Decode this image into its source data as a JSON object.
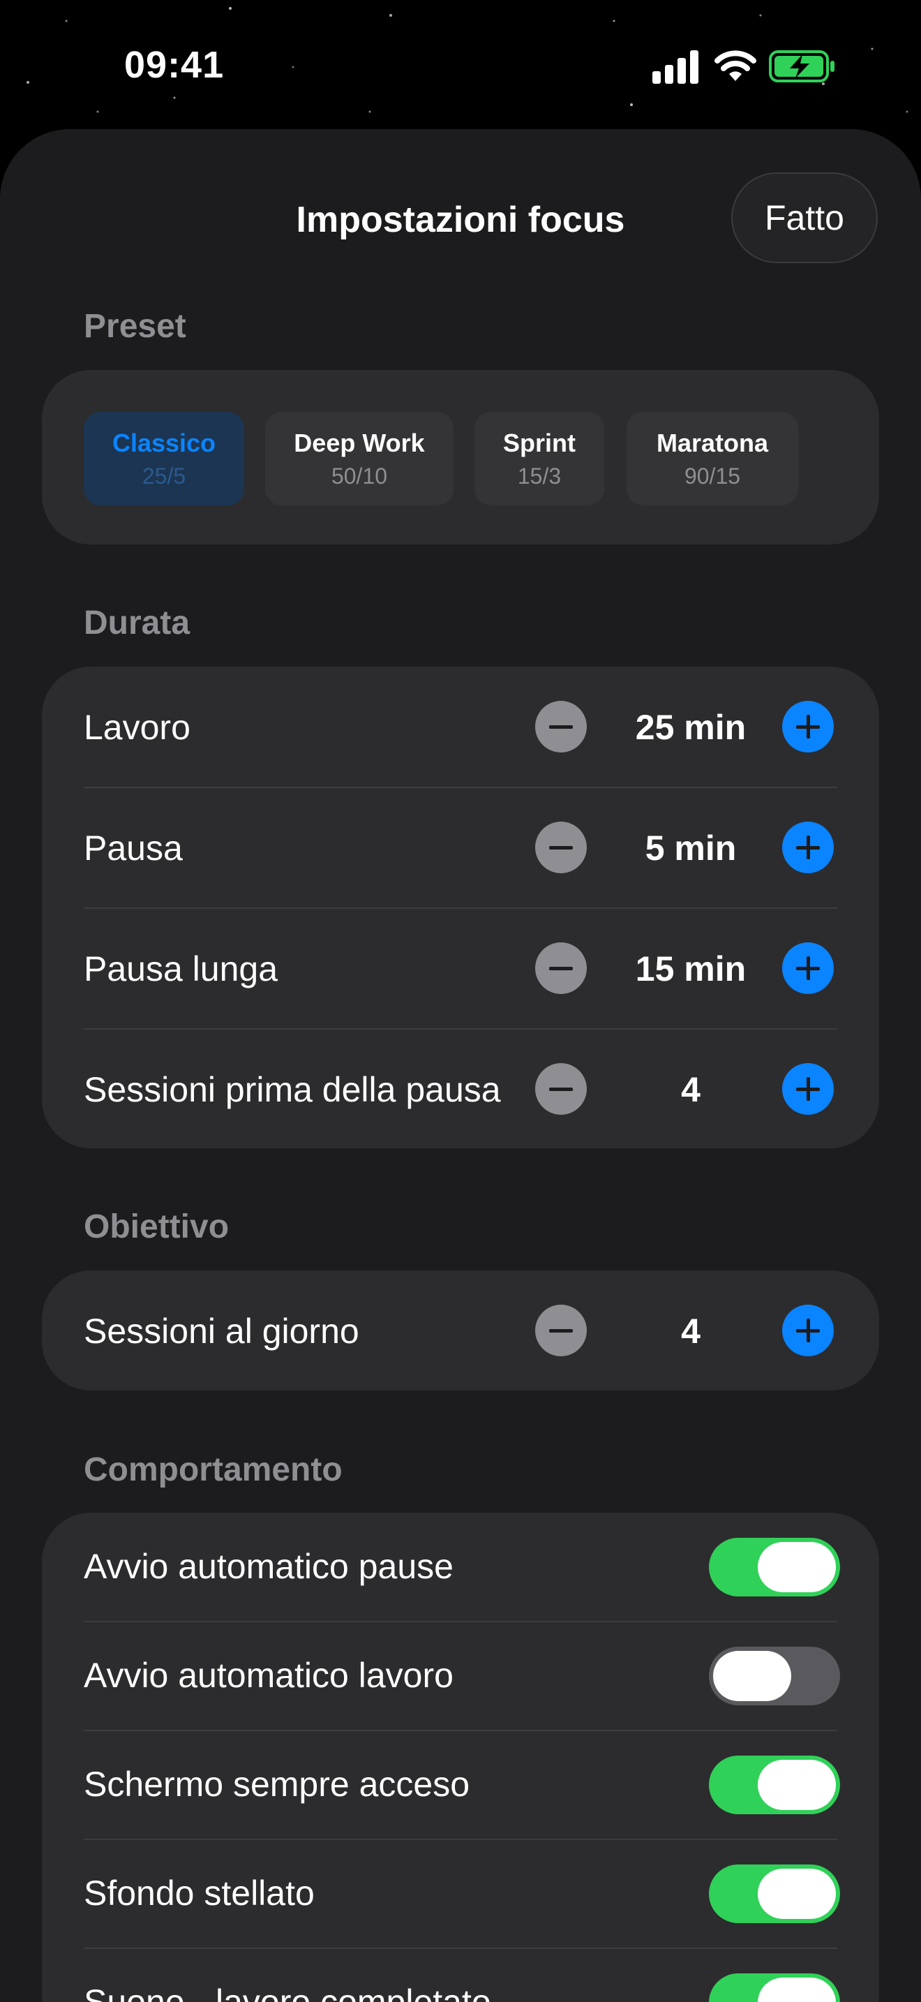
{
  "status_bar": {
    "time": "09:41"
  },
  "header": {
    "title": "Impostazioni focus",
    "done_label": "Fatto"
  },
  "preset": {
    "section_label": "Preset",
    "items": [
      {
        "name": "Classico",
        "value": "25/5",
        "selected": true
      },
      {
        "name": "Deep Work",
        "value": "50/10",
        "selected": false
      },
      {
        "name": "Sprint",
        "value": "15/3",
        "selected": false
      },
      {
        "name": "Maratona",
        "value": "90/15",
        "selected": false
      }
    ]
  },
  "durata": {
    "section_label": "Durata",
    "rows": [
      {
        "label": "Lavoro",
        "value": "25 min"
      },
      {
        "label": "Pausa",
        "value": "5 min"
      },
      {
        "label": "Pausa lunga",
        "value": "15 min"
      },
      {
        "label": "Sessioni prima della pausa",
        "value": "4"
      }
    ]
  },
  "obiettivo": {
    "section_label": "Obiettivo",
    "rows": [
      {
        "label": "Sessioni al giorno",
        "value": "4"
      }
    ]
  },
  "comportamento": {
    "section_label": "Comportamento",
    "rows": [
      {
        "label": "Avvio automatico pause",
        "on": true
      },
      {
        "label": "Avvio automatico lavoro",
        "on": false
      },
      {
        "label": "Schermo sempre acceso",
        "on": true
      },
      {
        "label": "Sfondo stellato",
        "on": true
      },
      {
        "label": "Suono - lavoro completato",
        "on": true
      }
    ]
  },
  "colors": {
    "accent": "#0a84ff",
    "toggle_on": "#30d158",
    "background": "#1c1c1e",
    "card": "#2c2c2e"
  }
}
